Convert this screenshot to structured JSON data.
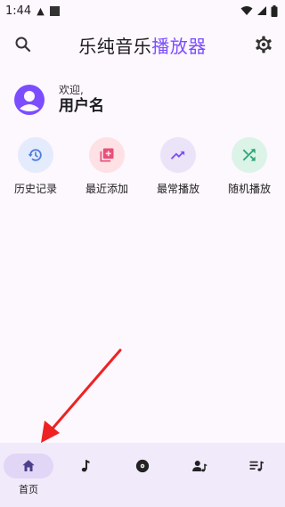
{
  "status": {
    "time": "1:44"
  },
  "header": {
    "title_main": "乐纯音乐",
    "title_accent": "播放器",
    "accent_color": "#7c4dff",
    "left_icon": "search-icon",
    "right_icon": "gear-icon"
  },
  "user": {
    "welcome": "欢迎,",
    "name": "用户名"
  },
  "quick_actions": [
    {
      "label": "历史记录",
      "icon": "history-icon",
      "bg": "#e4ebfc",
      "fg": "#4f7de0"
    },
    {
      "label": "最近添加",
      "icon": "library-add-icon",
      "bg": "#fde1e4",
      "fg": "#e6507a"
    },
    {
      "label": "最常播放",
      "icon": "trending-up-icon",
      "bg": "#ebe3f8",
      "fg": "#7c4dff"
    },
    {
      "label": "随机播放",
      "icon": "shuffle-icon",
      "bg": "#dcf3e8",
      "fg": "#2fa776"
    }
  ],
  "bottom_nav": {
    "items": [
      {
        "label": "首页",
        "icon": "home-icon",
        "active": true
      },
      {
        "icon": "music-note-icon"
      },
      {
        "icon": "album-icon"
      },
      {
        "icon": "artist-icon"
      },
      {
        "icon": "playlist-icon"
      }
    ]
  }
}
